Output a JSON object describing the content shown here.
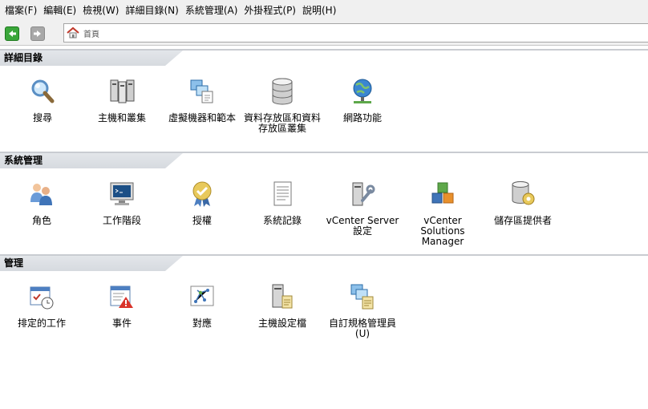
{
  "menu": [
    "檔案(F)",
    "編輯(E)",
    "檢視(W)",
    "詳細目錄(N)",
    "系統管理(A)",
    "外掛程式(P)",
    "說明(H)"
  ],
  "address": {
    "text": "首頁"
  },
  "sections": [
    {
      "title": "詳細目錄",
      "items": [
        {
          "label": "搜尋",
          "icon": "search-icon"
        },
        {
          "label": "主機和叢集",
          "icon": "hosts-clusters-icon"
        },
        {
          "label": "虛擬機器和範本",
          "icon": "vms-templates-icon"
        },
        {
          "label": "資料存放區和資料存放區叢集",
          "icon": "datastore-icon"
        },
        {
          "label": "網路功能",
          "icon": "networking-icon"
        }
      ]
    },
    {
      "title": "系統管理",
      "items": [
        {
          "label": "角色",
          "icon": "roles-icon"
        },
        {
          "label": "工作階段",
          "icon": "sessions-icon"
        },
        {
          "label": "授權",
          "icon": "licensing-icon"
        },
        {
          "label": "系統記錄",
          "icon": "system-logs-icon"
        },
        {
          "label": "vCenter Server 設定",
          "icon": "vcenter-settings-icon"
        },
        {
          "label": "vCenter Solutions Manager",
          "icon": "solutions-manager-icon"
        },
        {
          "label": "儲存區提供者",
          "icon": "storage-providers-icon"
        }
      ]
    },
    {
      "title": "管理",
      "items": [
        {
          "label": "排定的工作",
          "icon": "scheduled-tasks-icon"
        },
        {
          "label": "事件",
          "icon": "events-icon"
        },
        {
          "label": "對應",
          "icon": "maps-icon"
        },
        {
          "label": "主機設定檔",
          "icon": "host-profiles-icon"
        },
        {
          "label": "自訂規格管理員(U)",
          "icon": "customization-manager-icon"
        }
      ]
    }
  ]
}
